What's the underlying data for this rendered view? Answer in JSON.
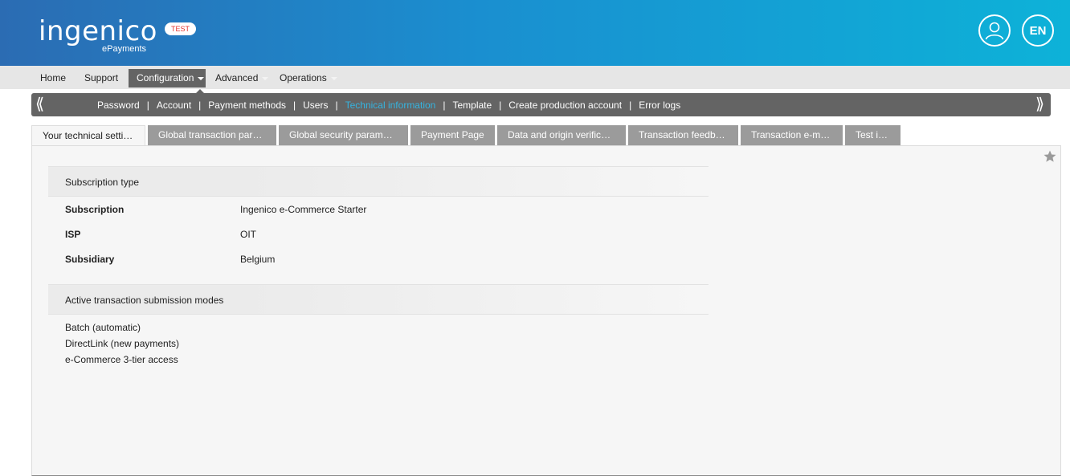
{
  "header": {
    "logo_main": "ingenico",
    "logo_sub": "ePayments",
    "env_badge": "TEST",
    "lang": "EN",
    "user_icon": "user-icon"
  },
  "topnav": {
    "items": [
      {
        "label": "Home"
      },
      {
        "label": "Support"
      },
      {
        "label": "Configuration"
      },
      {
        "label": "Advanced"
      },
      {
        "label": "Operations"
      }
    ],
    "active": "Configuration"
  },
  "subbar": {
    "prev_icon": "double-chevron-left-icon",
    "next_icon": "double-chevron-right-icon",
    "items": [
      {
        "label": "Password"
      },
      {
        "label": "Account"
      },
      {
        "label": "Payment methods"
      },
      {
        "label": "Users"
      },
      {
        "label": "Technical information"
      },
      {
        "label": "Template"
      },
      {
        "label": "Create production account"
      },
      {
        "label": "Error logs"
      }
    ],
    "current": "Technical information",
    "current_color": "#35b4e0"
  },
  "tabs": [
    {
      "label": "Your technical settings"
    },
    {
      "label": "Global transaction para…"
    },
    {
      "label": "Global security paramet…"
    },
    {
      "label": "Payment Page"
    },
    {
      "label": "Data and origin verificat…"
    },
    {
      "label": "Transaction feedback"
    },
    {
      "label": "Transaction e-mails"
    },
    {
      "label": "Test info"
    }
  ],
  "content": {
    "favorite_icon": "star-icon",
    "subscription_section": {
      "title": "Subscription type",
      "rows": [
        {
          "label": "Subscription",
          "value": "Ingenico e-Commerce Starter"
        },
        {
          "label": "ISP",
          "value": "OIT"
        },
        {
          "label": "Subsidiary",
          "value": "Belgium"
        }
      ]
    },
    "modes_section": {
      "title": "Active transaction submission modes",
      "items": [
        "Batch (automatic)",
        "DirectLink (new payments)",
        "e-Commerce 3-tier access"
      ]
    }
  },
  "colors": {
    "header_start": "#2b6cb3",
    "header_end": "#0db2d8",
    "badge_text": "#e3342f",
    "dark_bar": "#646464"
  }
}
